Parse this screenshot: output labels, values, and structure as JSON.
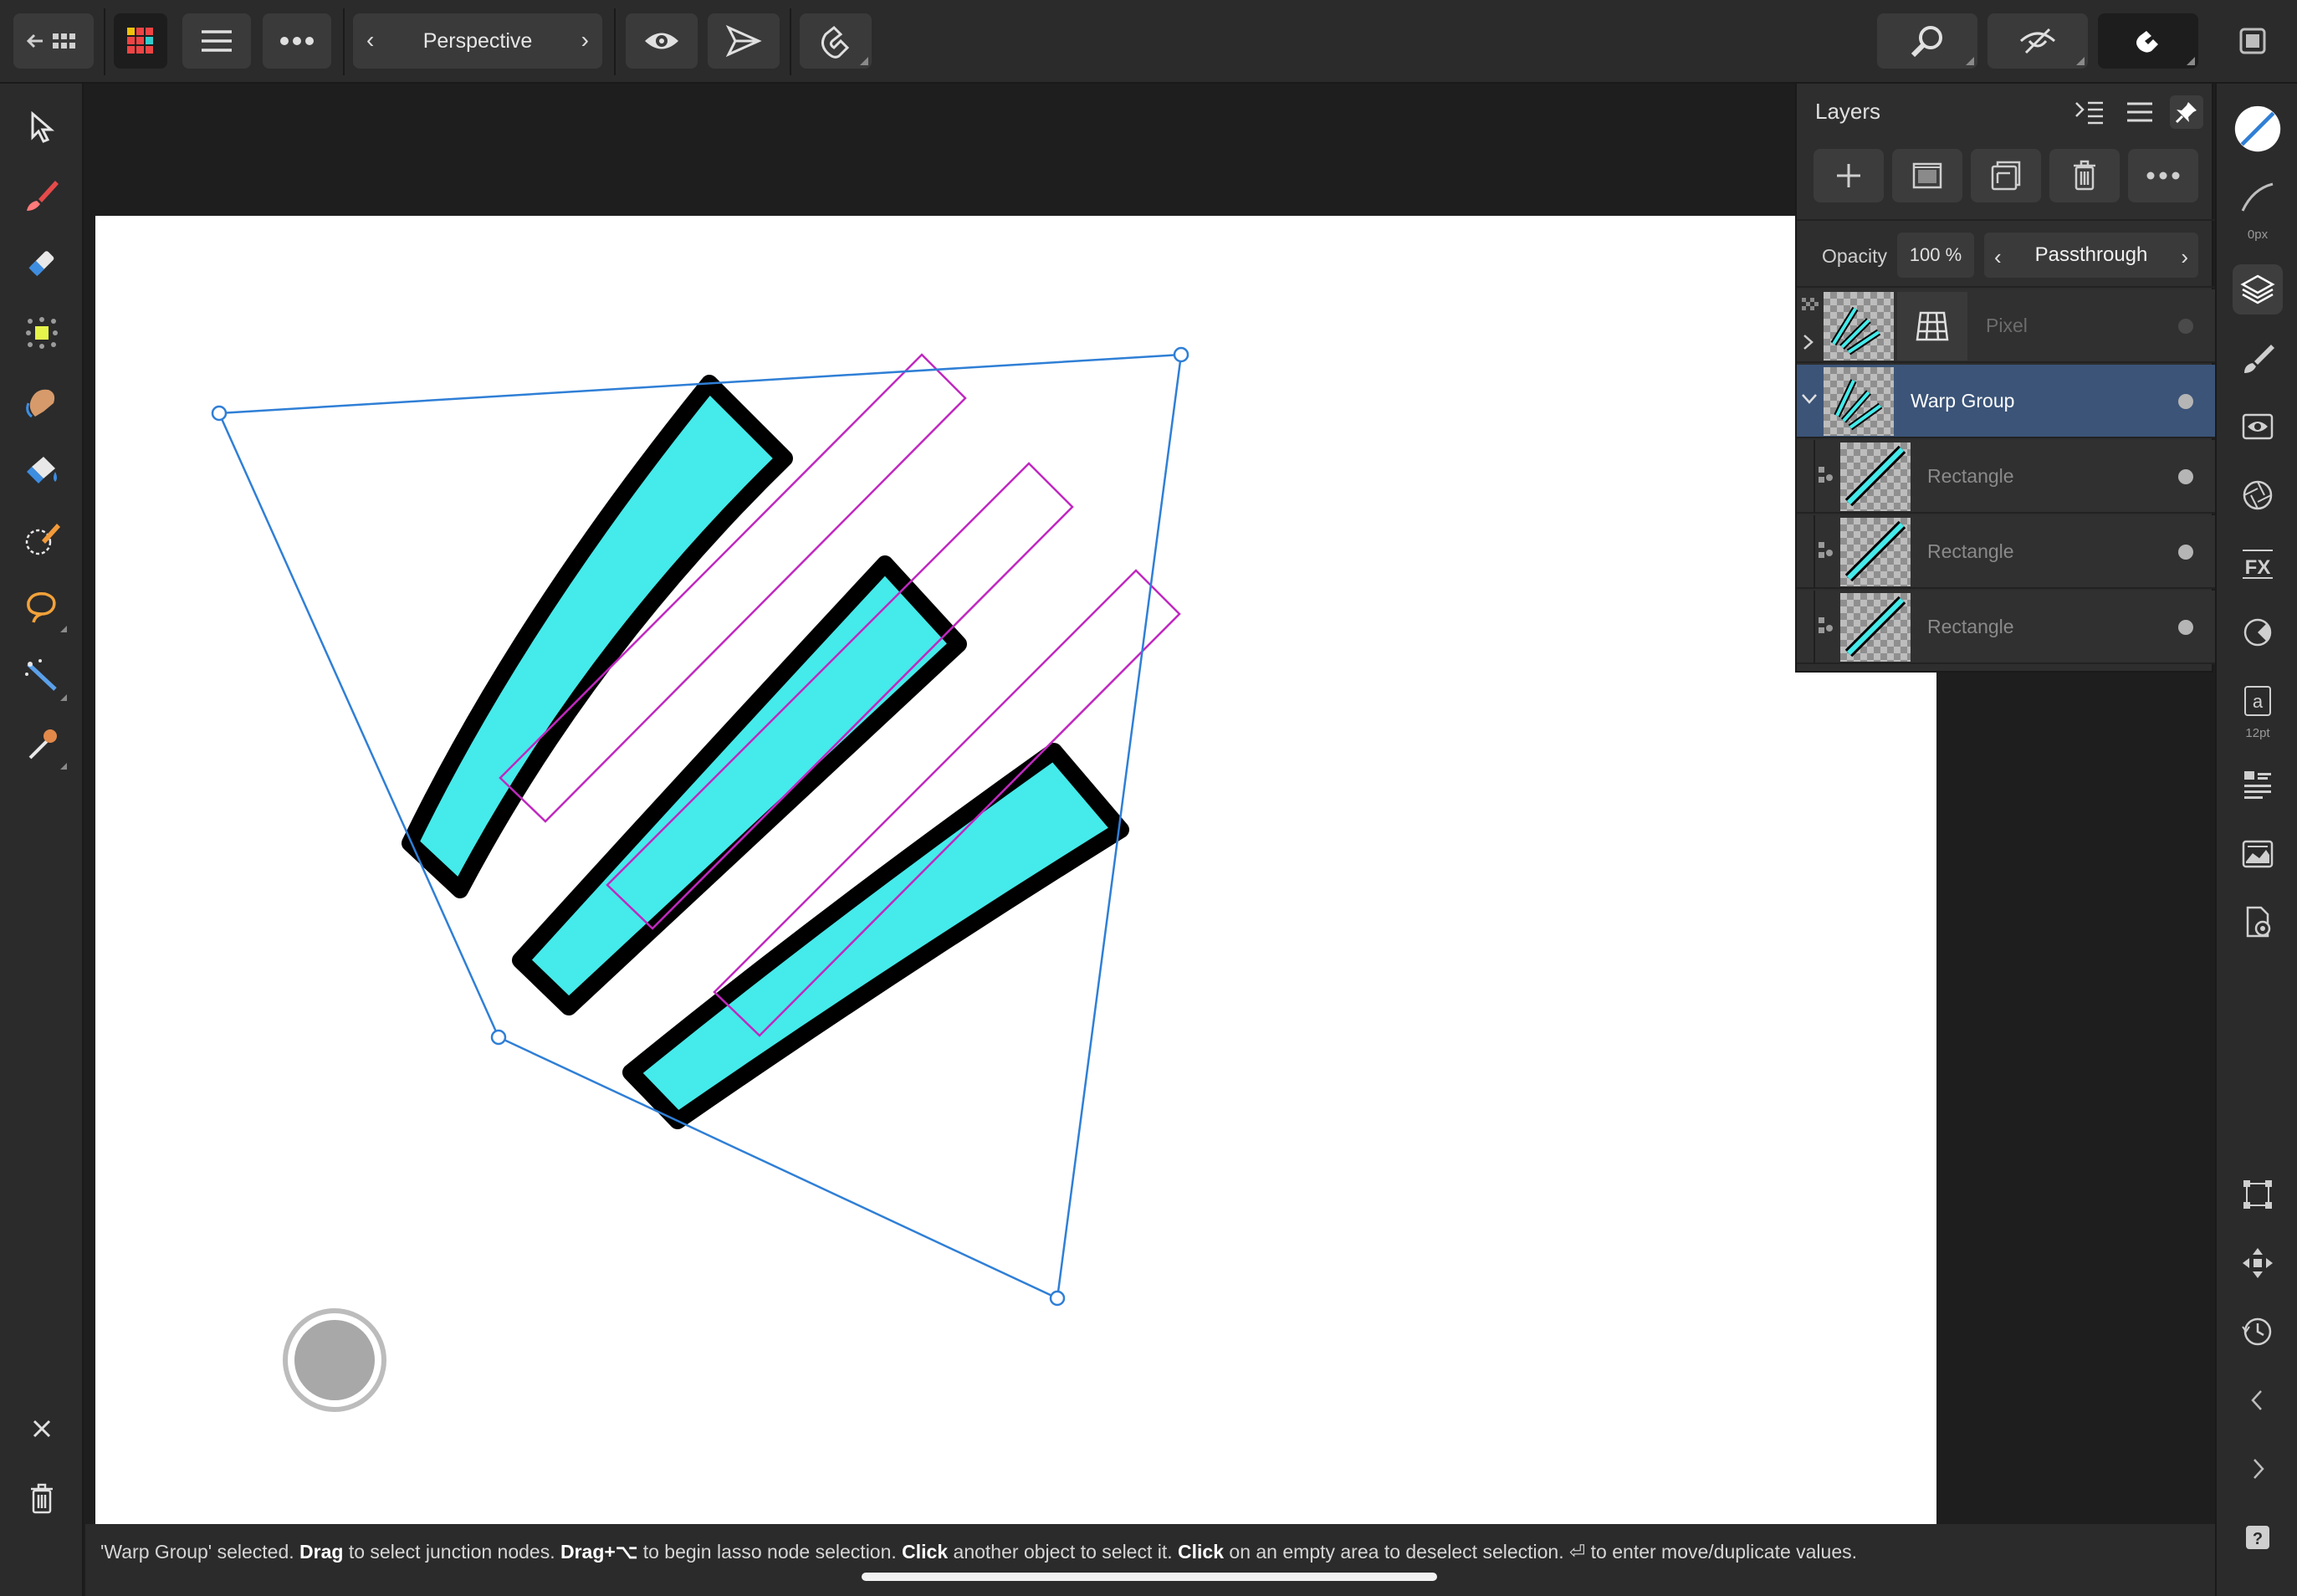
{
  "topbar": {
    "persona_label": "Perspective",
    "buttons": [
      "back-to-home",
      "personas",
      "menu",
      "more",
      "view-mode",
      "export",
      "snapping",
      "zoom",
      "preview",
      "assistant",
      "fullscreen"
    ]
  },
  "layers_panel": {
    "title": "Layers",
    "opacity_label": "Opacity",
    "opacity_value": "100 %",
    "blend_mode": "Passthrough",
    "layers": [
      {
        "name": "Pixel",
        "selected": false,
        "visible": false
      },
      {
        "name": "Warp Group",
        "selected": true,
        "visible": true
      },
      {
        "name": "Rectangle",
        "selected": false,
        "visible": true
      },
      {
        "name": "Rectangle",
        "selected": false,
        "visible": true
      },
      {
        "name": "Rectangle",
        "selected": false,
        "visible": true
      }
    ]
  },
  "studio": {
    "stroke_width": "0px",
    "font_size": "12pt"
  },
  "status": {
    "p1": "'Warp Group' selected. ",
    "b1": "Drag",
    "p2": " to select junction nodes. ",
    "b2": "Drag+⌥",
    "p3": " to begin lasso node selection. ",
    "b3": "Click",
    "p4": " another object to select it. ",
    "b4": "Click",
    "p5": " on an empty area to deselect selection. ⏎ to enter move/duplicate values."
  },
  "colors": {
    "accent_selection": "#3b5478",
    "warp_outline": "#2f7fd6",
    "shape_fill": "#45eaea",
    "guide_rect": "#c028c0"
  }
}
